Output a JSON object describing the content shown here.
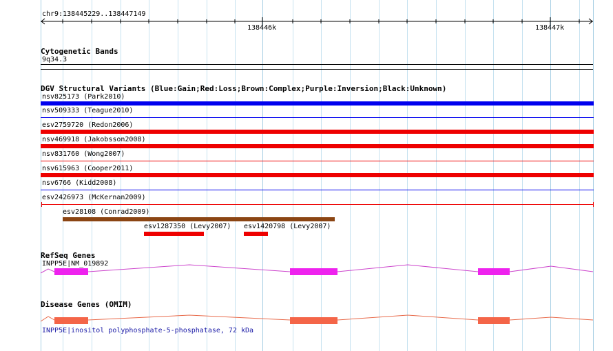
{
  "ruler": {
    "location": "chr9:138445229..138447149",
    "ticks": [
      "138446k",
      "138447k"
    ]
  },
  "cytoband": {
    "title": "Cytogenetic Bands",
    "band": "9q34.3"
  },
  "dgv": {
    "title": "DGV Structural Variants (Blue:Gain;Red:Loss;Brown:Complex;Purple:Inversion;Black:Unknown)",
    "colors": {
      "gain": "#0000ee",
      "loss": "#ee0000",
      "complex": "#8b4513"
    },
    "variants": [
      {
        "label": "nsv825173 (Park2010)",
        "type": "gain",
        "style": "thick"
      },
      {
        "label": "nsv509333 (Teague2010)",
        "type": "gain",
        "style": "thin"
      },
      {
        "label": "esv2759720 (Redon2006)",
        "type": "loss",
        "style": "thick"
      },
      {
        "label": "nsv469918 (Jakobsson2008)",
        "type": "loss",
        "style": "thick"
      },
      {
        "label": "nsv831760 (Wong2007)",
        "type": "loss",
        "style": "thin"
      },
      {
        "label": "nsv615963 (Cooper2011)",
        "type": "loss",
        "style": "thick"
      },
      {
        "label": "nsv6766 (Kidd2008)",
        "type": "gain",
        "style": "thin"
      },
      {
        "label": "esv2426973 (McKernan2009)",
        "type": "loss",
        "style": "capped"
      },
      {
        "label": "esv28108 (Conrad2009)",
        "type": "complex",
        "style": "short"
      },
      {
        "label": "esv1287350 (Levy2007)",
        "type": "loss",
        "style": "short"
      },
      {
        "label": "esv1420798 (Levy2007)",
        "type": "loss",
        "style": "short"
      }
    ]
  },
  "refseq": {
    "title": "RefSeq Genes",
    "gene_label": "INPP5E|NM_019892",
    "color": "#ee22ee",
    "line_color": "#cc44cc"
  },
  "disease": {
    "title": "Disease Genes (OMIM)",
    "gene_label": "INPP5E|inositol polyphosphate-5-phosphatase, 72 kDa",
    "color": "#f46548",
    "line_color": "#e86a4a"
  }
}
